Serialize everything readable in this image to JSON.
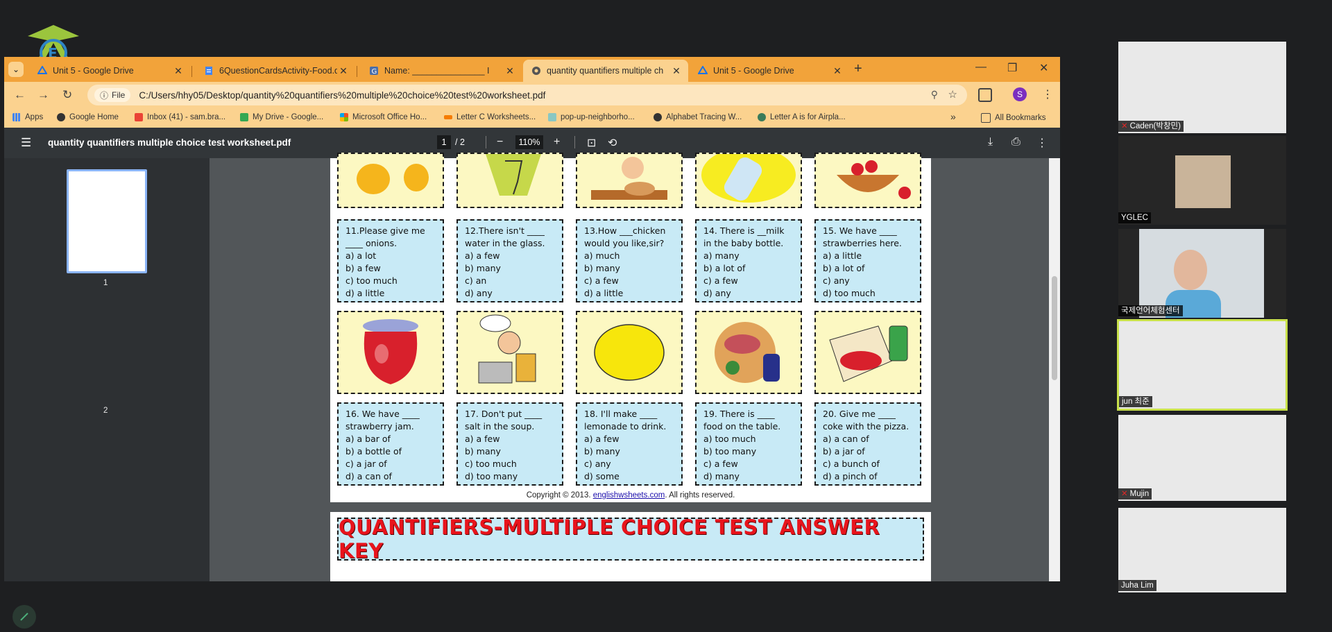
{
  "browser": {
    "tabs": [
      {
        "title": "Unit 5 - Google Drive",
        "icon": "google-drive-icon"
      },
      {
        "title": "6QuestionCardsActivity-Food.d",
        "icon": "docs-icon"
      },
      {
        "title": "Name: _______________ I",
        "icon": "google-classroom-icon"
      },
      {
        "title": "quantity quantifiers multiple ch",
        "icon": "chrome-page-icon",
        "active": true
      },
      {
        "title": "Unit 5 - Google Drive",
        "icon": "google-drive-icon"
      }
    ],
    "new_tab": "+",
    "address": {
      "chip": "File",
      "url": "C:/Users/hhy05/Desktop/quantity%20quantifiers%20multiple%20choice%20test%20worksheet.pdf"
    },
    "profile_initial": "S",
    "bookmarks": [
      {
        "label": "Apps"
      },
      {
        "label": "Google Home"
      },
      {
        "label": "Inbox (41) - sam.bra..."
      },
      {
        "label": "My Drive - Google..."
      },
      {
        "label": "Microsoft Office Ho..."
      },
      {
        "label": "Letter C Worksheets..."
      },
      {
        "label": "pop-up-neighborho..."
      },
      {
        "label": "Alphabet Tracing W..."
      },
      {
        "label": "Letter A is for Airpla..."
      }
    ],
    "bookmarks_more": "»",
    "all_bookmarks": "All Bookmarks"
  },
  "pdf": {
    "title": "quantity quantifiers multiple choice test worksheet.pdf",
    "page_current": "1",
    "page_total": "/ 2",
    "zoom": "110%",
    "thumbnails": [
      "1",
      "2"
    ]
  },
  "worksheet": {
    "questions": [
      {
        "lines": [
          "11.Please give me",
          "____ onions.",
          "a) a lot",
          "b) a few",
          "c)  too much",
          "d) a little"
        ]
      },
      {
        "lines": [
          "12.There isn't ____",
          "water in the glass.",
          "a) a few",
          "b) many",
          "c) an",
          "d) any"
        ]
      },
      {
        "lines": [
          "13.How ___chicken",
          "would you like,sir?",
          "a) much",
          "b) many",
          "c)  a few",
          "d) a little"
        ]
      },
      {
        "lines": [
          "14. There is __milk",
          "in the baby bottle.",
          "a) many",
          "b) a lot of",
          "c)  a few",
          "d) any"
        ]
      },
      {
        "lines": [
          "15. We have ____",
          "strawberries here.",
          "a) a little",
          "b) a lot of",
          "c)  any",
          "d) too much"
        ]
      },
      {
        "lines": [
          "16. We have ____",
          "strawberry  jam.",
          "a) a bar of",
          "b) a bottle of",
          "c)  a jar of",
          "d) a can of"
        ]
      },
      {
        "lines": [
          "17. Don't put ____",
          "salt in the soup.",
          "a) a few",
          "b) many",
          "c)  too much",
          "d) too many"
        ]
      },
      {
        "lines": [
          "18. I'll make ____",
          "lemonade to drink.",
          "a) a few",
          "b) many",
          "c)  any",
          "d) some"
        ]
      },
      {
        "lines": [
          "19. There is ____",
          "food on the table.",
          "a) too much",
          "b) too many",
          "c)  a few",
          "d) many"
        ]
      },
      {
        "lines": [
          "20. Give me ____",
          "coke with the pizza.",
          "a) a can of",
          "b) a jar of",
          "c)  a bunch of",
          "d) a pinch of"
        ]
      }
    ],
    "copyright_pre": "Copyright © 2013. ",
    "copyright_link": "englishwsheets.com",
    "copyright_post": ". All rights reserved.",
    "answer_key_title": "QUANTIFIERS-MULTIPLE CHOICE TEST ANSWER KEY"
  },
  "participants": [
    {
      "name": "Caden(박창민)",
      "muted": true
    },
    {
      "name": "YGLEC",
      "muted": false
    },
    {
      "name": "국제언어체험센터",
      "muted": false
    },
    {
      "name": "jun 최준",
      "muted": false,
      "active_speaker": true
    },
    {
      "name": "Mujin",
      "muted": true
    },
    {
      "name": "Juha Lim",
      "muted": false
    }
  ],
  "colors": {
    "tab_bar": "#f2a33a",
    "toolbar": "#fbd28f",
    "pdf_toolbar": "#323639",
    "question_bg": "#c8eaf6",
    "image_bg": "#fcf8c2",
    "answer_key_text": "#e8141c",
    "active_speaker": "#c8e04a"
  }
}
